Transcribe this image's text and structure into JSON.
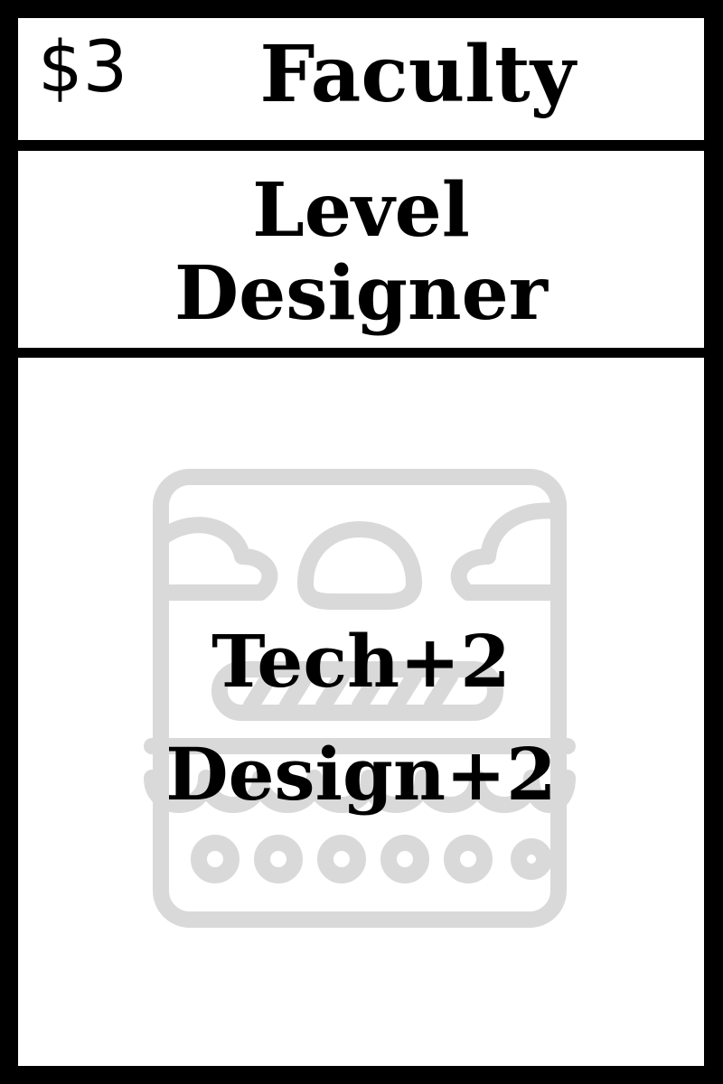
{
  "card": {
    "cost": "$3",
    "category": "Faculty",
    "name_lines": [
      "Level",
      "Designer"
    ],
    "effects": [
      "Tech+2",
      "Design+2"
    ],
    "illustration_icon": "game-level-icon"
  },
  "colors": {
    "border": "#000000",
    "panel": "#ffffff",
    "text": "#000000",
    "illustration": "#d9d9d9"
  }
}
